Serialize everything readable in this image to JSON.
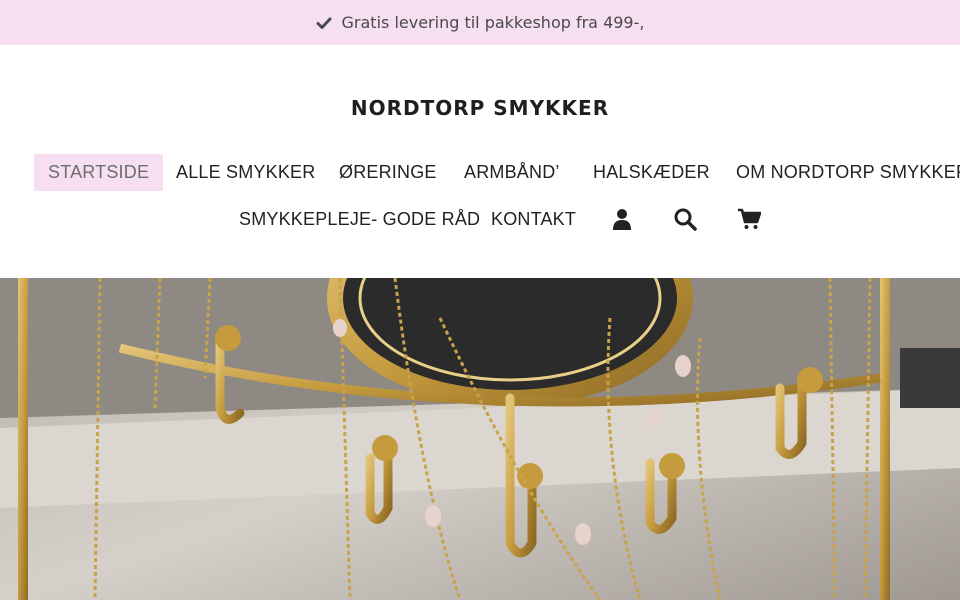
{
  "announcement": {
    "icon": "checkmark-icon",
    "text": "Gratis levering til pakkeshop fra 499-,"
  },
  "brand": {
    "name": "NORDTORP SMYKKER"
  },
  "nav": {
    "items": [
      {
        "label": "STARTSIDE",
        "active": true
      },
      {
        "label": "ALLE SMYKKER"
      },
      {
        "label": "ØRERINGE"
      },
      {
        "label": "ARMBÅND’"
      },
      {
        "label": "HALSKÆDER"
      },
      {
        "label": "OM NORDTORP SMYKKER"
      },
      {
        "label": "SMYKKEPLEJE- GODE RÅD"
      },
      {
        "label": "KONTAKT"
      }
    ],
    "icons": [
      "account-icon",
      "search-icon",
      "cart-icon"
    ]
  },
  "hero": {
    "image": "gold-jewelry-on-mirror-stand-photo"
  },
  "colors": {
    "accent_pink": "#f6dff0",
    "text_dark": "#222222",
    "gold": "#c9a24a"
  }
}
